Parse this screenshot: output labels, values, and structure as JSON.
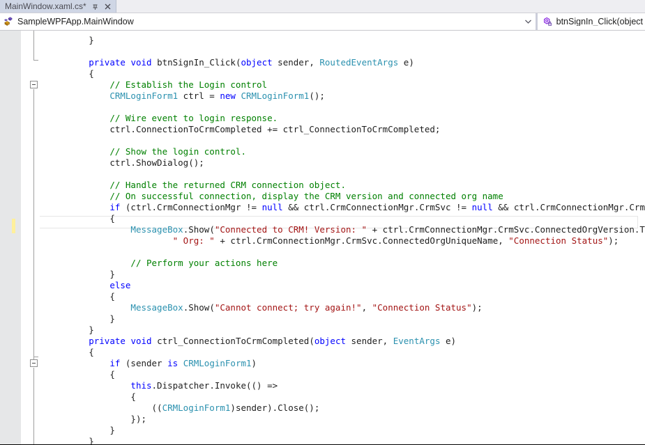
{
  "window": {
    "title": "MainWindow.xaml.cs*"
  },
  "tabbar": {
    "tabs": [
      {
        "label": "MainWindow.xaml.cs*",
        "modified": true,
        "active": true
      }
    ],
    "pin_icon": "pin-icon",
    "close_icon": "close-icon"
  },
  "navbar": {
    "left": {
      "icon": "class-icon",
      "text": "SampleWPFApp.MainWindow",
      "arrow_icon": "chevron-down-icon"
    },
    "right": {
      "icon": "method-private-icon",
      "text": "btnSignIn_Click(object"
    }
  },
  "editor": {
    "language": "csharp",
    "current_line_marker": "yellow-change-bar",
    "outline_boxes": [
      "collapse-method-btnSignIn",
      "collapse-method-ctrl-ConnectionToCrmCompleted"
    ],
    "colors": {
      "keyword": "#0000ff",
      "type": "#2b91af",
      "comment": "#008000",
      "string": "#a31515",
      "plain": "#1e1e1e",
      "background": "#ffffff",
      "indicator_margin": "#e6e7e8",
      "change_marker": "#fff09c",
      "tab_active": "#cfd6e5"
    },
    "lines": [
      {
        "indent": 2,
        "tokens": [
          {
            "t": "}",
            "c": "pl"
          }
        ]
      },
      {
        "indent": 0,
        "tokens": []
      },
      {
        "indent": 2,
        "tokens": [
          {
            "t": "private",
            "c": "kw"
          },
          {
            "t": " ",
            "c": "pl"
          },
          {
            "t": "void",
            "c": "kw"
          },
          {
            "t": " btnSignIn_Click(",
            "c": "pl"
          },
          {
            "t": "object",
            "c": "kw"
          },
          {
            "t": " sender, ",
            "c": "pl"
          },
          {
            "t": "RoutedEventArgs",
            "c": "typ"
          },
          {
            "t": " e)",
            "c": "pl"
          }
        ]
      },
      {
        "indent": 2,
        "tokens": [
          {
            "t": "{",
            "c": "pl"
          }
        ]
      },
      {
        "indent": 3,
        "tokens": [
          {
            "t": "// Establish the Login control",
            "c": "cmt"
          }
        ]
      },
      {
        "indent": 3,
        "tokens": [
          {
            "t": "CRMLoginForm1",
            "c": "typ"
          },
          {
            "t": " ctrl = ",
            "c": "pl"
          },
          {
            "t": "new",
            "c": "kw"
          },
          {
            "t": " ",
            "c": "pl"
          },
          {
            "t": "CRMLoginForm1",
            "c": "typ"
          },
          {
            "t": "();",
            "c": "pl"
          }
        ]
      },
      {
        "indent": 0,
        "tokens": []
      },
      {
        "indent": 3,
        "tokens": [
          {
            "t": "// Wire event to login response.",
            "c": "cmt"
          }
        ]
      },
      {
        "indent": 3,
        "tokens": [
          {
            "t": "ctrl.ConnectionToCrmCompleted += ctrl_ConnectionToCrmCompleted;",
            "c": "pl"
          }
        ]
      },
      {
        "indent": 0,
        "tokens": []
      },
      {
        "indent": 3,
        "tokens": [
          {
            "t": "// Show the login control.",
            "c": "cmt"
          }
        ]
      },
      {
        "indent": 3,
        "tokens": [
          {
            "t": "ctrl.ShowDialog();",
            "c": "pl"
          }
        ]
      },
      {
        "indent": 0,
        "tokens": []
      },
      {
        "indent": 3,
        "tokens": [
          {
            "t": "// Handle the returned CRM connection object.",
            "c": "cmt"
          }
        ]
      },
      {
        "indent": 3,
        "tokens": [
          {
            "t": "// On successful connection, display the CRM version and connected org name",
            "c": "cmt"
          }
        ]
      },
      {
        "indent": 3,
        "tokens": [
          {
            "t": "if",
            "c": "kw"
          },
          {
            "t": " (ctrl.CrmConnectionMgr != ",
            "c": "pl"
          },
          {
            "t": "null",
            "c": "kw"
          },
          {
            "t": " && ctrl.CrmConnectionMgr.CrmSvc != ",
            "c": "pl"
          },
          {
            "t": "null",
            "c": "kw"
          },
          {
            "t": " && ctrl.CrmConnectionMgr.CrmSvc.IsReady)",
            "c": "pl"
          }
        ]
      },
      {
        "indent": 3,
        "tokens": [
          {
            "t": "{",
            "c": "pl"
          }
        ]
      },
      {
        "indent": 4,
        "tokens": [
          {
            "t": "MessageBox",
            "c": "typ"
          },
          {
            "t": ".Show(",
            "c": "pl"
          },
          {
            "t": "\"Connected to CRM! Version: \"",
            "c": "str"
          },
          {
            "t": " + ctrl.CrmConnectionMgr.CrmSvc.ConnectedOrgVersion.ToString() +",
            "c": "pl"
          }
        ]
      },
      {
        "indent": 6,
        "tokens": [
          {
            "t": "\" Org: \"",
            "c": "str"
          },
          {
            "t": " + ctrl.CrmConnectionMgr.CrmSvc.ConnectedOrgUniqueName, ",
            "c": "pl"
          },
          {
            "t": "\"Connection Status\"",
            "c": "str"
          },
          {
            "t": ");",
            "c": "pl"
          }
        ]
      },
      {
        "indent": 0,
        "tokens": []
      },
      {
        "indent": 4,
        "tokens": [
          {
            "t": "// Perform your actions here",
            "c": "cmt"
          }
        ]
      },
      {
        "indent": 3,
        "tokens": [
          {
            "t": "}",
            "c": "pl"
          }
        ]
      },
      {
        "indent": 3,
        "tokens": [
          {
            "t": "else",
            "c": "kw"
          }
        ]
      },
      {
        "indent": 3,
        "tokens": [
          {
            "t": "{",
            "c": "pl"
          }
        ]
      },
      {
        "indent": 4,
        "tokens": [
          {
            "t": "MessageBox",
            "c": "typ"
          },
          {
            "t": ".Show(",
            "c": "pl"
          },
          {
            "t": "\"Cannot connect; try again!\"",
            "c": "str"
          },
          {
            "t": ", ",
            "c": "pl"
          },
          {
            "t": "\"Connection Status\"",
            "c": "str"
          },
          {
            "t": ");",
            "c": "pl"
          }
        ]
      },
      {
        "indent": 3,
        "tokens": [
          {
            "t": "}",
            "c": "pl"
          }
        ]
      },
      {
        "indent": 2,
        "tokens": [
          {
            "t": "}",
            "c": "pl"
          }
        ]
      },
      {
        "indent": 2,
        "tokens": [
          {
            "t": "private",
            "c": "kw"
          },
          {
            "t": " ",
            "c": "pl"
          },
          {
            "t": "void",
            "c": "kw"
          },
          {
            "t": " ctrl_ConnectionToCrmCompleted(",
            "c": "pl"
          },
          {
            "t": "object",
            "c": "kw"
          },
          {
            "t": " sender, ",
            "c": "pl"
          },
          {
            "t": "EventArgs",
            "c": "typ"
          },
          {
            "t": " e)",
            "c": "pl"
          }
        ]
      },
      {
        "indent": 2,
        "tokens": [
          {
            "t": "{",
            "c": "pl"
          }
        ]
      },
      {
        "indent": 3,
        "tokens": [
          {
            "t": "if",
            "c": "kw"
          },
          {
            "t": " (sender ",
            "c": "pl"
          },
          {
            "t": "is",
            "c": "kw"
          },
          {
            "t": " ",
            "c": "pl"
          },
          {
            "t": "CRMLoginForm1",
            "c": "typ"
          },
          {
            "t": ")",
            "c": "pl"
          }
        ]
      },
      {
        "indent": 3,
        "tokens": [
          {
            "t": "{",
            "c": "pl"
          }
        ]
      },
      {
        "indent": 4,
        "tokens": [
          {
            "t": "this",
            "c": "kw"
          },
          {
            "t": ".Dispatcher.Invoke(() =>",
            "c": "pl"
          }
        ]
      },
      {
        "indent": 4,
        "tokens": [
          {
            "t": "{",
            "c": "pl"
          }
        ]
      },
      {
        "indent": 5,
        "tokens": [
          {
            "t": "((",
            "c": "pl"
          },
          {
            "t": "CRMLoginForm1",
            "c": "typ"
          },
          {
            "t": ")sender).Close();",
            "c": "pl"
          }
        ]
      },
      {
        "indent": 4,
        "tokens": [
          {
            "t": "});",
            "c": "pl"
          }
        ]
      },
      {
        "indent": 3,
        "tokens": [
          {
            "t": "}",
            "c": "pl"
          }
        ]
      },
      {
        "indent": 2,
        "tokens": [
          {
            "t": "}",
            "c": "pl"
          }
        ]
      }
    ]
  }
}
